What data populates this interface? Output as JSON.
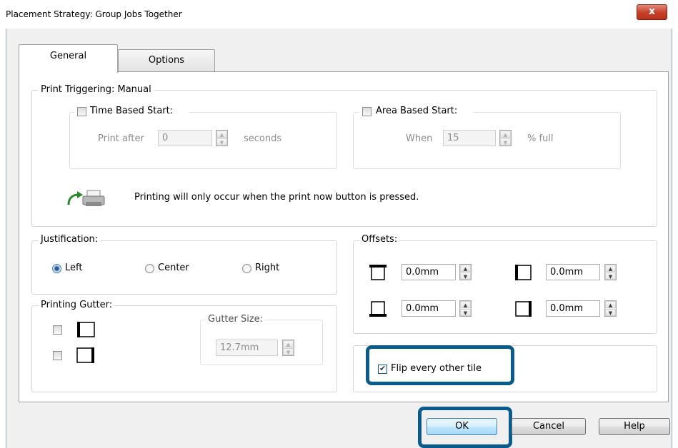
{
  "window": {
    "title": "Placement Strategy: Group Jobs Together",
    "close_label": "x"
  },
  "tabs": [
    {
      "label": "General"
    },
    {
      "label": "Options"
    }
  ],
  "print_triggering": {
    "label": "Print Triggering: Manual",
    "time_based": {
      "label": "Time Based Start:",
      "checked": false,
      "prefix": "Print after",
      "value": "0",
      "suffix": "seconds"
    },
    "area_based": {
      "label": "Area Based Start:",
      "checked": false,
      "prefix": "When",
      "value": "15",
      "suffix": "% full"
    },
    "message": "Printing will only occur when the print now button is pressed.",
    "icon": "print-trigger-icon"
  },
  "justification": {
    "label": "Justification:",
    "options": [
      {
        "label": "Left",
        "selected": true
      },
      {
        "label": "Center",
        "selected": false
      },
      {
        "label": "Right",
        "selected": false
      }
    ]
  },
  "printing_gutter": {
    "label": "Printing Gutter:",
    "gutter_size_label": "Gutter Size:",
    "gutter_size_value": "12.7mm"
  },
  "offsets": {
    "label": "Offsets:",
    "top": "0.0mm",
    "left": "0.0mm",
    "bottom": "0.0mm",
    "right": "0.0mm"
  },
  "flip": {
    "label": "Flip every other tile",
    "checked": true
  },
  "buttons": {
    "ok": "OK",
    "cancel": "Cancel",
    "help": "Help"
  },
  "colors": {
    "highlight": "#0a5a8c",
    "close_button": "#c7432d"
  }
}
